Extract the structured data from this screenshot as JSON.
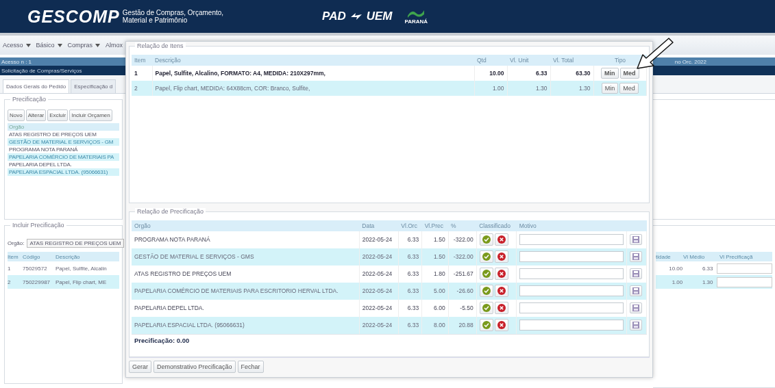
{
  "header": {
    "logo": "GESCOMP",
    "subtitle_line_1": "Gestão de Compras, Orçamento,",
    "subtitle_line_2": "Material e Patrimônio",
    "partner_logo": "PAD",
    "partner_logo_2": "UEM",
    "state_logo": "PARANÁ"
  },
  "menu": [
    {
      "label": "Acesso",
      "dropdown": true
    },
    {
      "label": "Básico",
      "dropdown": true
    },
    {
      "label": "Compras",
      "dropdown": true
    },
    {
      "label": "Almox",
      "dropdown": false
    }
  ],
  "access_bar": {
    "left": "Acesso n : 1",
    "right": "no Orc. 2022"
  },
  "page_title": "Solicitação de Compras/Serviços",
  "tabs": [
    {
      "label": "Dados Gerais do Pedido",
      "selected": true
    },
    {
      "label": "Especificação d",
      "selected": false
    }
  ],
  "pricing_panel": {
    "legend": "Precificação",
    "buttons": [
      "Novo",
      "Alterar",
      "Excluir",
      "Incluir Orçamen"
    ],
    "list_header": "Orgão",
    "list": [
      "ATAS REGISTRO DE PREÇOS UEM",
      "GESTÃO DE MATERIAL E SERVIÇOS - GM",
      "PROGRAMA NOTA PARANÁ",
      "PAPELARIA COMÉRCIO DE MATERIAIS PA",
      "PAPELARIA DEPEL LTDA.",
      "PAPELARIA ESPACIAL LTDA. (95066631)"
    ]
  },
  "include_panel": {
    "legend": "Incluir Precificação",
    "org_label": "Orgão:",
    "org_value": "ATAS REGISTRO DE PREÇOS UEM",
    "columns": [
      "Item",
      "Código",
      "Descrição"
    ],
    "rows": [
      [
        "1",
        "75029572",
        "Papel, Sulfite, Alcalin"
      ],
      [
        "2",
        "750229987",
        "Papel, Flip chart, ME"
      ]
    ],
    "right_columns": [
      "tidade",
      "Vl Médio",
      "Vl Precificaçã"
    ],
    "right_rows": [
      [
        "10.00",
        "6.33"
      ],
      [
        "1.00",
        "1.30"
      ]
    ]
  },
  "dialog": {
    "items_legend": "Relação de Itens",
    "item_columns": [
      "Item",
      "Descrição",
      "Qtd",
      "Vl. Unit",
      "Vl. Total",
      "Tipo"
    ],
    "items": [
      {
        "item": "1",
        "description": "Papel, Sulfite, Alcalino, FORMATO: A4, MEDIDA: 210X297mm,",
        "qty": "10.00",
        "unit": "6.33",
        "total": "63.30",
        "selected": true,
        "buttons": [
          "Min",
          "Med"
        ]
      },
      {
        "item": "2",
        "description": "Papel, Flip chart, MEDIDA: 64X88cm, COR: Branco, Sulfite,",
        "qty": "1.00",
        "unit": "1.30",
        "total": "1.30",
        "selected": false,
        "buttons": [
          "Min",
          "Med"
        ]
      }
    ],
    "pricing_legend": "Relação de Precificação",
    "pricing_columns": [
      "Orgão",
      "Data",
      "Vl.Orc",
      "Vl.Prec",
      "%",
      "Classificado",
      "Motivo"
    ],
    "pricing_rows": [
      {
        "org": "PROGRAMA NOTA PARANÁ",
        "date": "2022-05-24",
        "orc": "6.33",
        "prec": "1.50",
        "pct": "-322.00"
      },
      {
        "org": "GESTÃO DE MATERIAL E SERVIÇOS - GMS",
        "date": "2022-05-24",
        "orc": "6.33",
        "prec": "1.50",
        "pct": "-322.00"
      },
      {
        "org": "ATAS REGISTRO DE PREÇOS UEM",
        "date": "2022-05-24",
        "orc": "6.33",
        "prec": "1.80",
        "pct": "-251.67"
      },
      {
        "org": "PAPELARIA COMÉRCIO DE MATERIAIS PARA ESCRITORIO HERVAL LTDA.",
        "date": "2022-05-24",
        "orc": "6.33",
        "prec": "5.00",
        "pct": "-26.60"
      },
      {
        "org": "PAPELARIA DEPEL LTDA.",
        "date": "2022-05-24",
        "orc": "6.33",
        "prec": "6.00",
        "pct": "-5.50"
      },
      {
        "org": "PAPELARIA ESPACIAL LTDA. (95066631)",
        "date": "2022-05-24",
        "orc": "6.33",
        "prec": "8.00",
        "pct": "20.88"
      }
    ],
    "total": "Precificação: 0.00",
    "buttons": [
      "Gerar",
      "Demonstrativo Precificação",
      "Fechar"
    ]
  }
}
